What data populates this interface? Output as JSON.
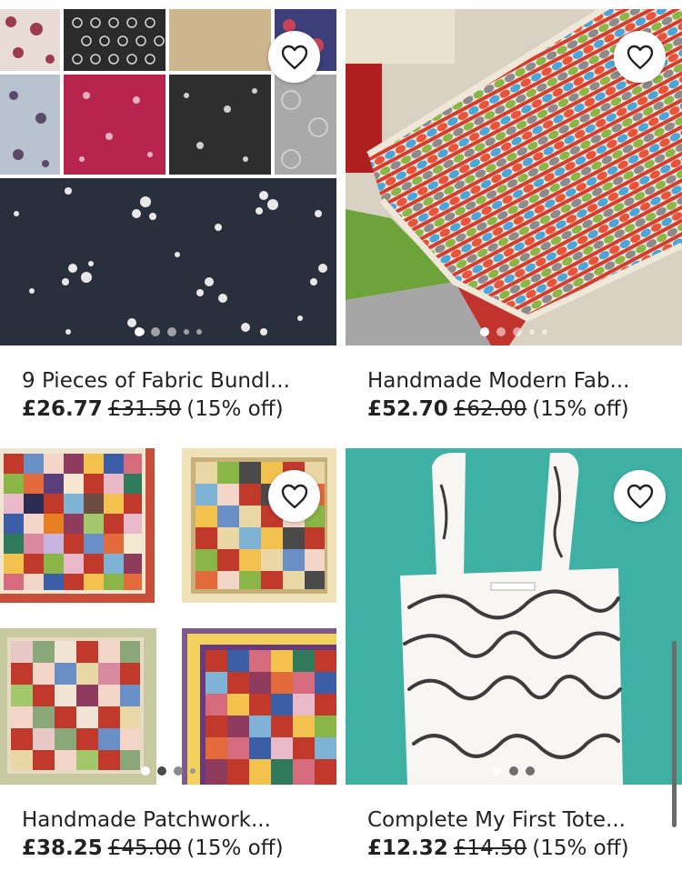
{
  "listings": [
    {
      "title": "9 Pieces of Fabric Bundl...",
      "price": "£26.77",
      "original_price": "£31.50",
      "discount": "(15% off)",
      "favorite_icon": "heart-outline",
      "image_dots": 5,
      "active_dot": 0
    },
    {
      "title": "Handmade Modern Fab...",
      "price": "£52.70",
      "original_price": "£62.00",
      "discount": "(15% off)",
      "favorite_icon": "heart-outline",
      "image_dots": 5,
      "active_dot": 0
    },
    {
      "title": "Handmade Patchwork...",
      "price": "£38.25",
      "original_price": "£45.00",
      "discount": "(15% off)",
      "favorite_icon": "heart-outline",
      "image_dots": 4,
      "active_dot": 0
    },
    {
      "title": "Complete My First Tote...",
      "price": "£12.32",
      "original_price": "£14.50",
      "discount": "(15% off)",
      "favorite_icon": "heart-outline",
      "image_dots": 3,
      "active_dot": 0
    }
  ],
  "colors": {
    "teal_background": "#3fb0a4",
    "navy_fabric": "#2a2f3d",
    "text": "#222222"
  }
}
